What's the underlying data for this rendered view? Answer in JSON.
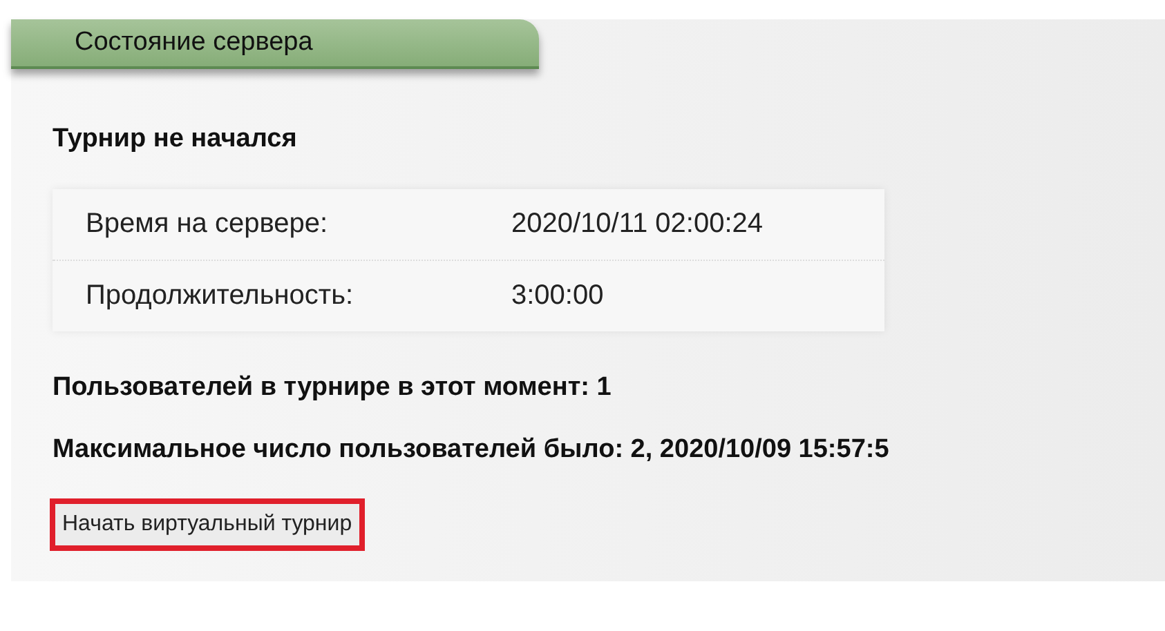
{
  "tab": {
    "title": "Состояние сервера"
  },
  "status": "Турнир не начался",
  "info_rows": [
    {
      "label": "Время на сервере:",
      "value": "2020/10/11 02:00:24"
    },
    {
      "label": "Продолжительность:",
      "value": "3:00:00"
    }
  ],
  "users_now": "Пользователей в турнире в этот момент: 1",
  "users_max": "Максимальное число пользователей было: 2, 2020/10/09 15:57:5",
  "button": {
    "label": "Начать виртуальный турнир"
  }
}
